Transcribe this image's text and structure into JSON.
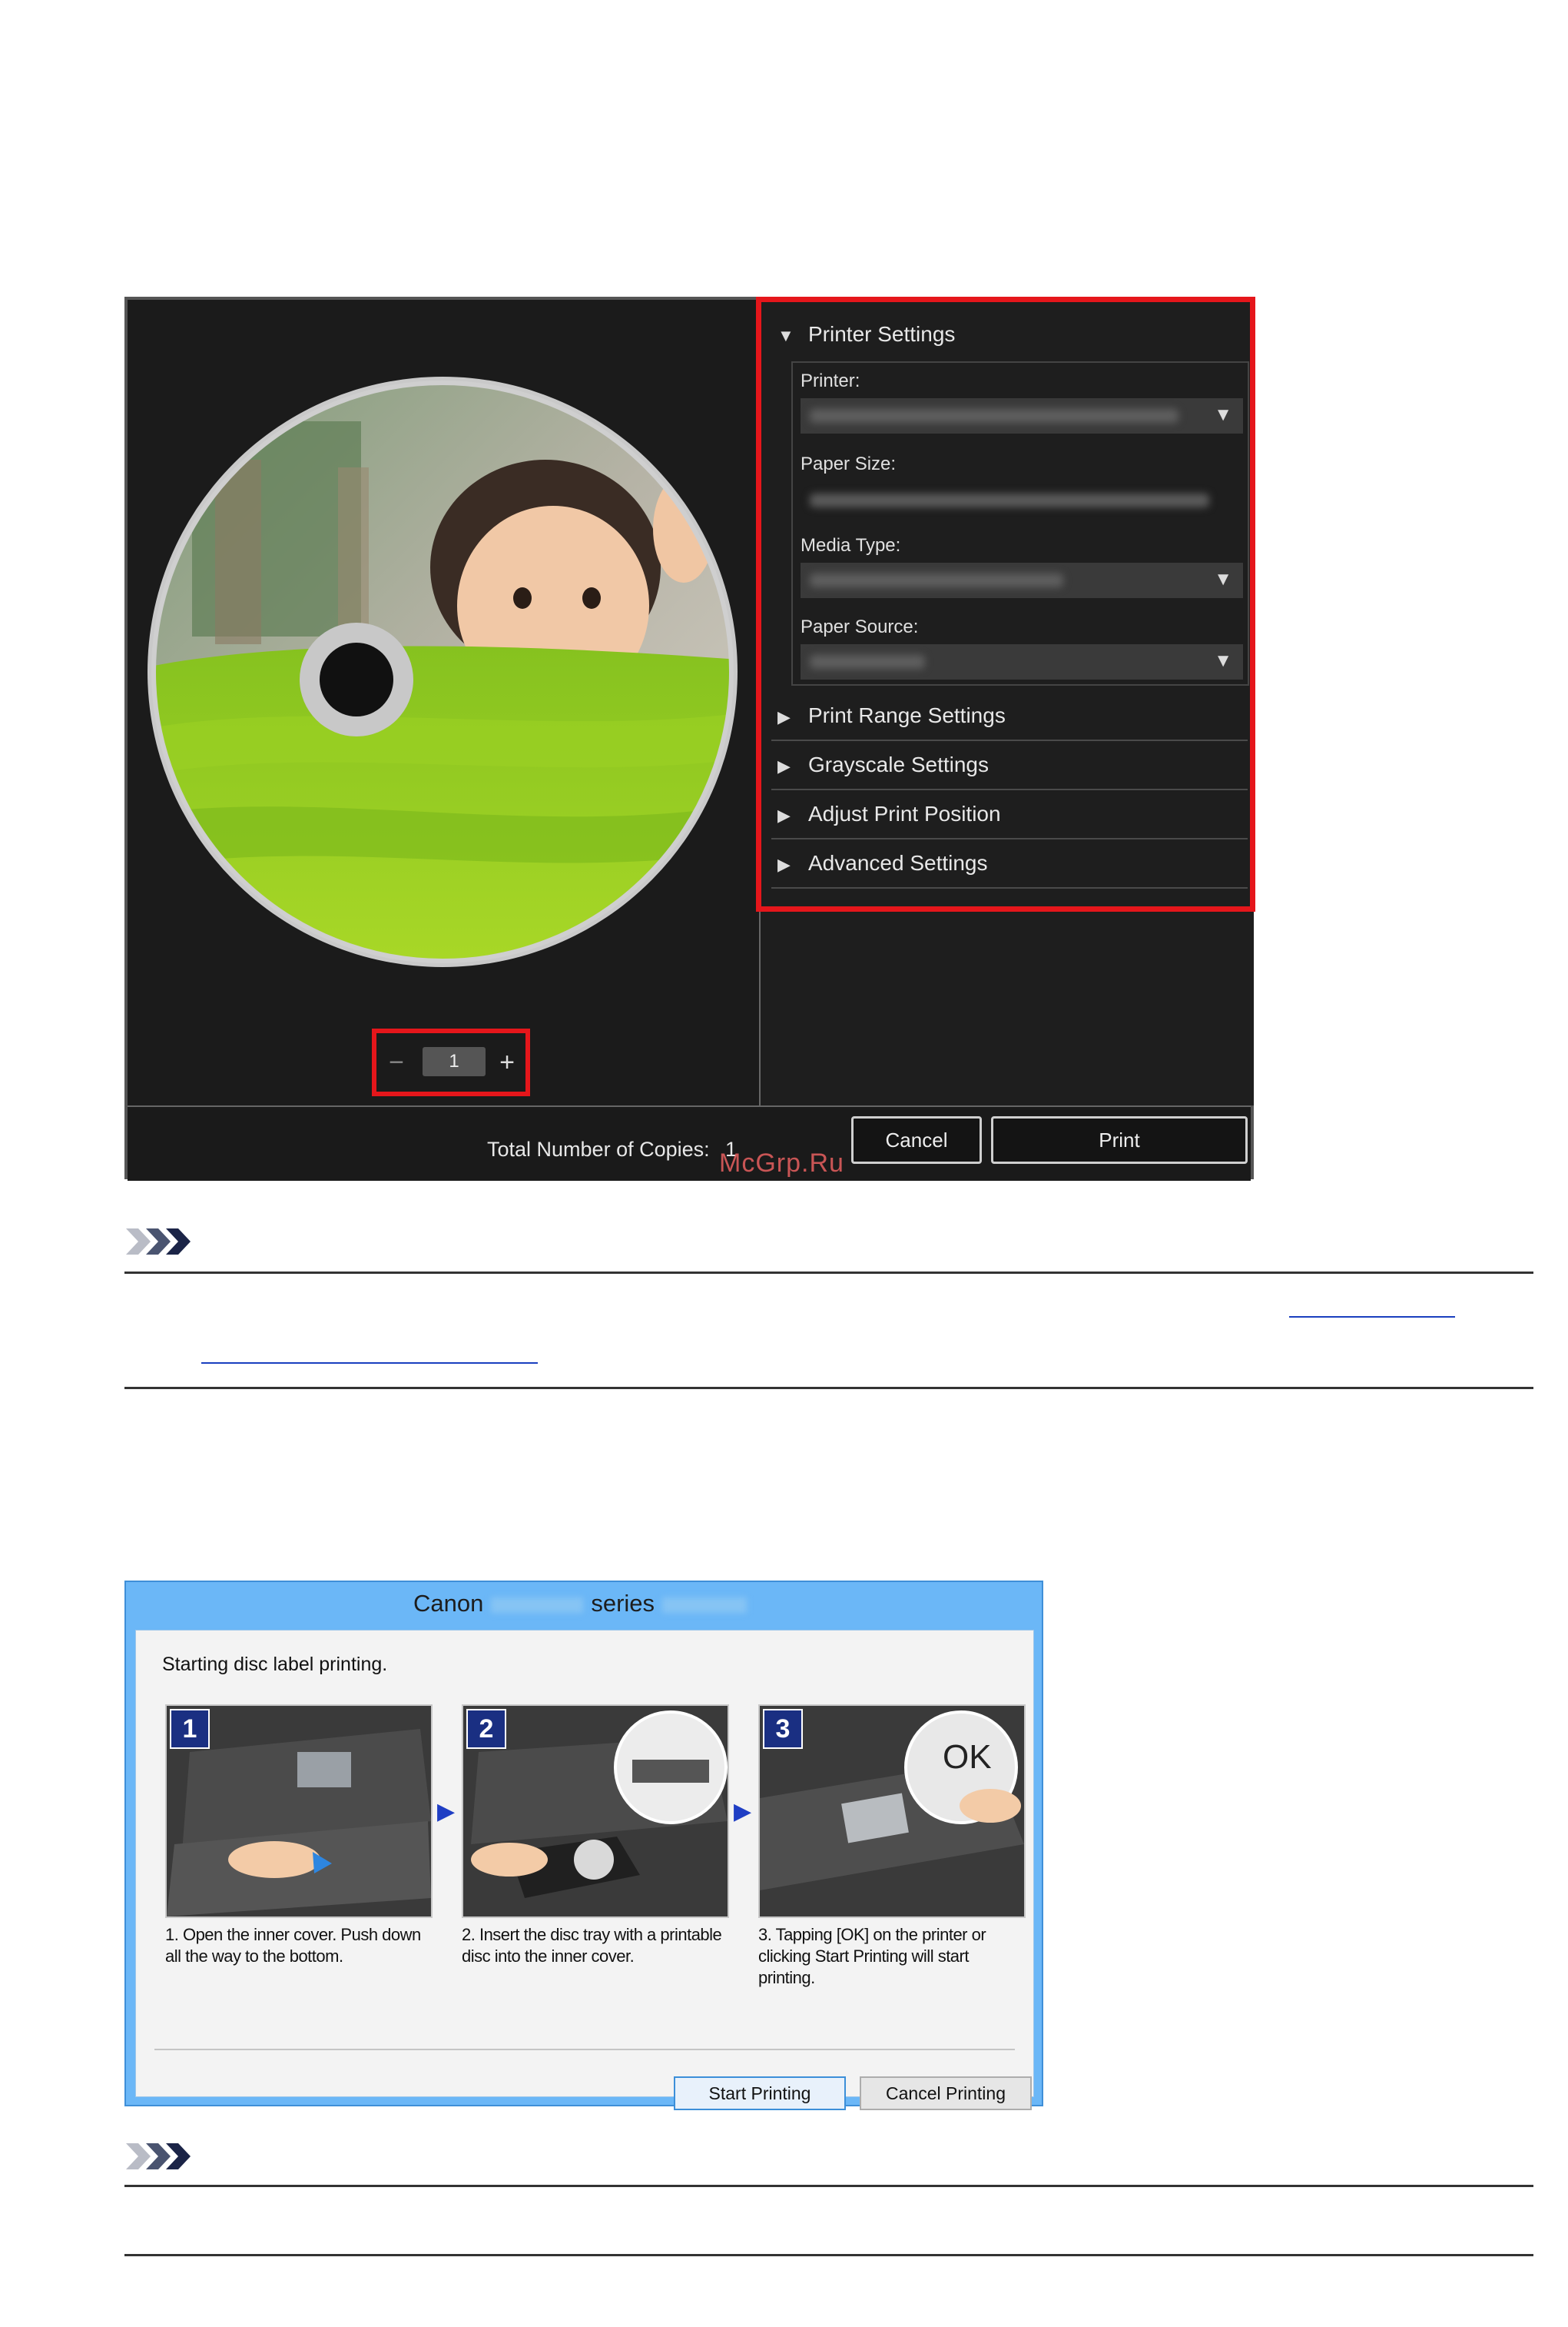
{
  "print_dialog": {
    "copies": {
      "minus": "−",
      "value": "1",
      "plus": "+"
    },
    "sections": {
      "printer_settings": "Printer Settings",
      "print_range": "Print Range Settings",
      "grayscale": "Grayscale Settings",
      "adjust_position": "Adjust Print Position",
      "advanced": "Advanced Settings"
    },
    "fields": {
      "printer_label": "Printer:",
      "paper_size_label": "Paper Size:",
      "media_type_label": "Media Type:",
      "paper_source_label": "Paper Source:"
    },
    "footer": {
      "total_label": "Total Number of Copies:",
      "total_value": "1",
      "cancel_label": "Cancel",
      "print_label": "Print"
    },
    "icons": {
      "expanded": "▼",
      "collapsed": "▶",
      "dropdown": "▼"
    }
  },
  "watermark": "McGrp.Ru",
  "canon_dialog": {
    "title_left": "Canon",
    "title_right": "series",
    "message": "Starting disc label printing.",
    "steps": [
      {
        "number": "1",
        "text": "1.  Open the inner cover. Push down all the way to the bottom."
      },
      {
        "number": "2",
        "text": "2.  Insert the disc tray with a printable disc into the inner cover."
      },
      {
        "number": "3",
        "text": "3.  Tapping [OK] on the printer or clicking Start Printing will start printing."
      }
    ],
    "ok_label": "OK",
    "start_label": "Start Printing",
    "cancel_label": "Cancel Printing"
  },
  "colors": {
    "highlight": "#e5161b",
    "dialog_bg": "#1c1c1c",
    "canon_titlebar": "#6bb7f7",
    "link": "#1a3fbf"
  }
}
